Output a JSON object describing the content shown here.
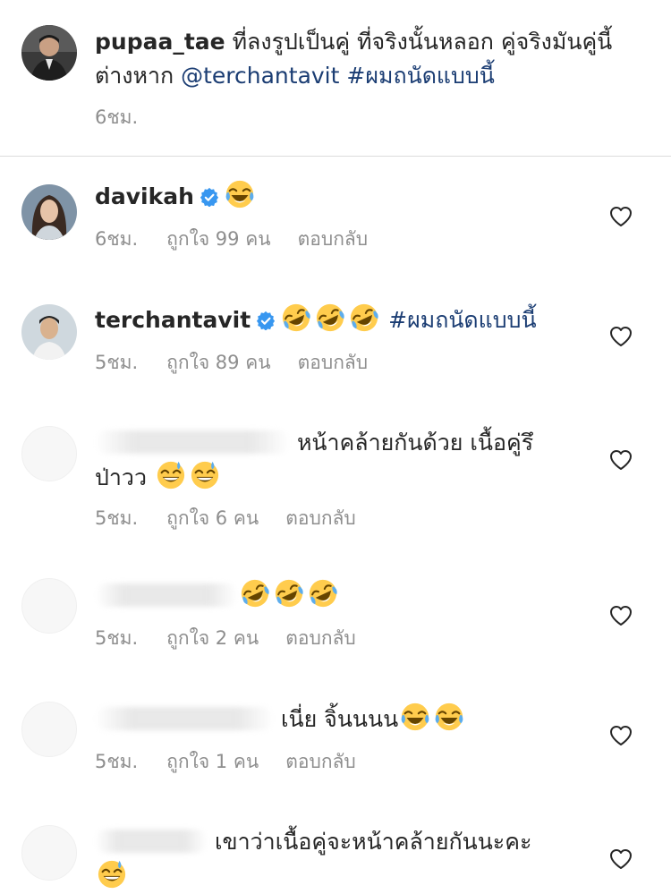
{
  "caption": {
    "username": "pupaa_tae",
    "text_line1": "ที่ลงรูปเป็นคู่ ที่จริงนั้นหลอก คู่จริงมันคู่นี้",
    "text_line2_prefix": "ต่างหาก ",
    "mention": "@terchantavit",
    "hashtag": "#ผมถนัดแบบนี้",
    "time": "6ชม."
  },
  "comments": [
    {
      "username": "davikah",
      "verified": true,
      "text": "",
      "emoji": [
        "laughing-tears"
      ],
      "time": "6ชม.",
      "likes": "ถูกใจ 99 คน",
      "reply": "ตอบกลับ"
    },
    {
      "username": "terchantavit",
      "verified": true,
      "emoji": [
        "rofl",
        "rofl",
        "rofl"
      ],
      "hashtag": "#ผมถนัดแบบนี้",
      "time": "5ชม.",
      "likes": "ถูกใจ 89 คน",
      "reply": "ตอบกลับ"
    },
    {
      "username_hidden": true,
      "text_line1": "หน้าคล้ายกันด้วย เนื้อคู่รึ",
      "text_line2": "ป่าวว",
      "emoji": [
        "sweat-smile",
        "sweat-smile"
      ],
      "time": "5ชม.",
      "likes": "ถูกใจ 6 คน",
      "reply": "ตอบกลับ"
    },
    {
      "username_hidden": true,
      "emoji": [
        "rofl",
        "rofl",
        "rofl"
      ],
      "time": "5ชม.",
      "likes": "ถูกใจ 2 คน",
      "reply": "ตอบกลับ"
    },
    {
      "username_hidden": true,
      "text": "เนี่ย จิ้นนนน",
      "emoji": [
        "laughing-tears",
        "laughing-tears"
      ],
      "time": "5ชม.",
      "likes": "ถูกใจ 1 คน",
      "reply": "ตอบกลับ"
    },
    {
      "username_hidden": true,
      "text": "เขาว่าเนื้อคู่จะหน้าคล้ายกันนะคะ",
      "emoji": [
        "sweat-smile"
      ]
    }
  ],
  "colors": {
    "text": "#262626",
    "meta": "#8e8e8e",
    "link": "#1b3d73",
    "verified": "#3897f0",
    "divider": "#dbdbdb"
  },
  "icons": {
    "verified": "verified-badge-icon",
    "like": "heart-outline-icon"
  }
}
